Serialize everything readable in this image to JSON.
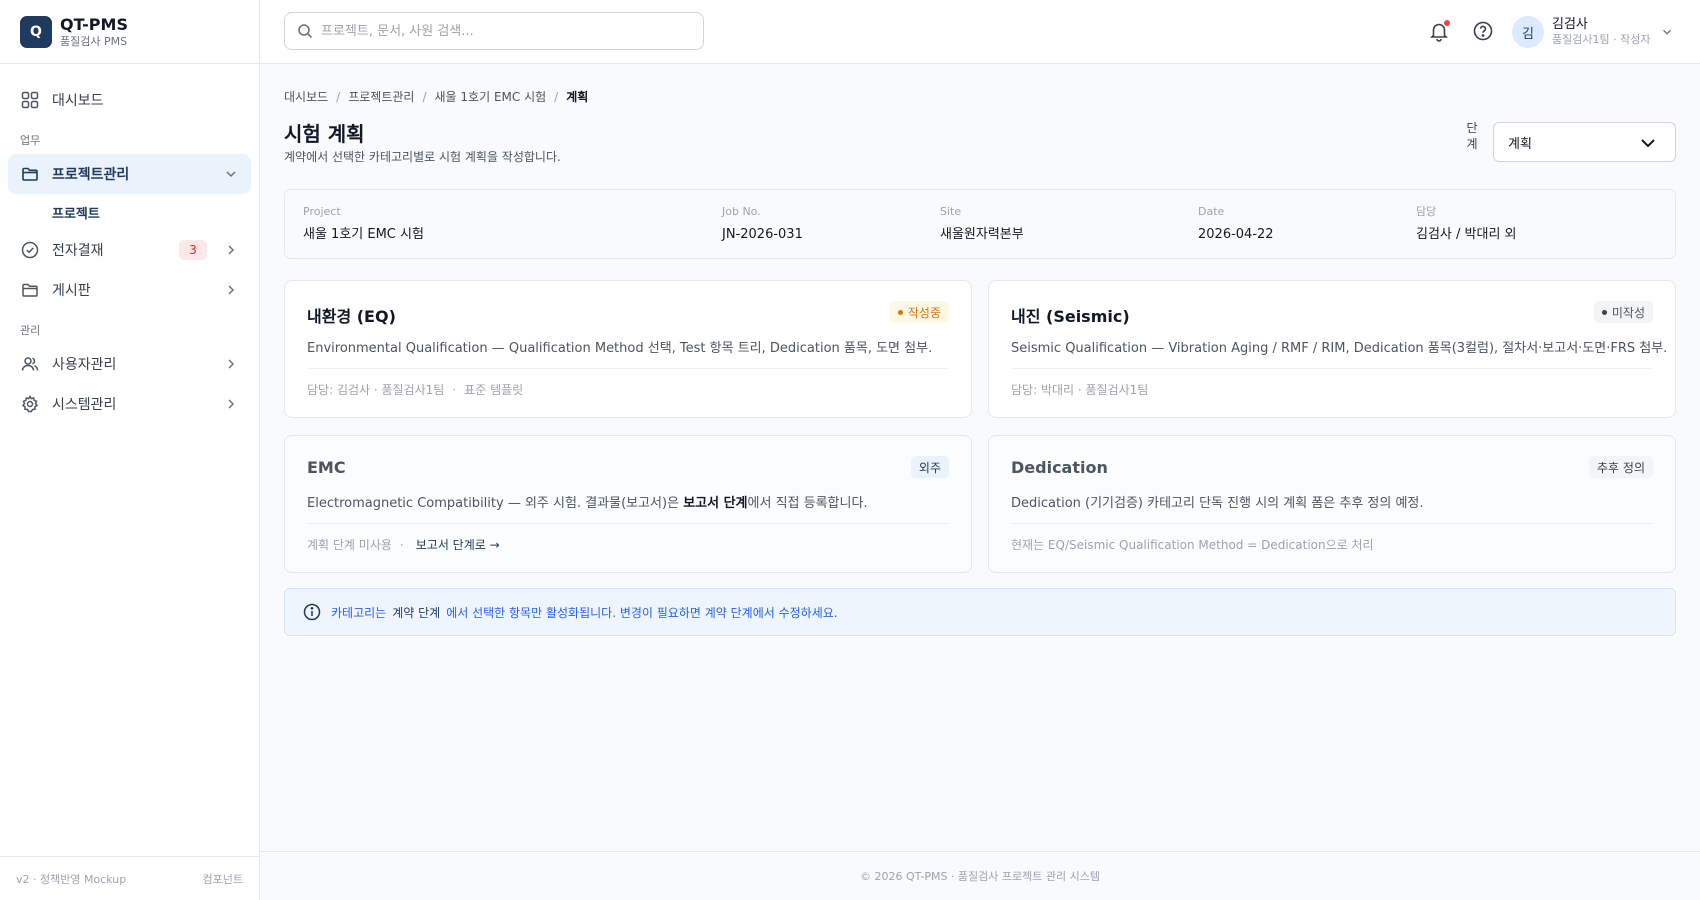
{
  "brand": {
    "logo_letter": "Q",
    "name": "QT-PMS",
    "subtitle": "품질검사 PMS"
  },
  "sidebar": {
    "dashboard": "대시보드",
    "section_work": "업무",
    "project_mgmt": "프로젝트관리",
    "project_sub": "프로젝트",
    "approval": "전자결재",
    "approval_badge": "3",
    "board": "게시판",
    "section_admin": "관리",
    "user_mgmt": "사용자관리",
    "system_mgmt": "시스템관리",
    "footer_version": "v2 · 정책반영 Mockup",
    "footer_right": "컴포넌트"
  },
  "header": {
    "search_placeholder": "프로젝트, 문서, 사원 검색...",
    "user_initial": "김",
    "user_name": "김검사",
    "user_role": "품질검사1팀 · 작성자"
  },
  "breadcrumb": [
    "대시보드",
    "프로젝트관리",
    "새울 1호기 EMC 시험",
    "계획"
  ],
  "page": {
    "title": "시험 계획",
    "description": "계약에서 선택한 카테고리별로 시험 계획을 작성합니다.",
    "stage_label": "단계",
    "stage_value": "계획"
  },
  "info": {
    "project_label": "Project",
    "project_value": "새울 1호기 EMC 시험",
    "job_label": "Job No.",
    "job_value": "JN-2026-031",
    "site_label": "Site",
    "site_value": "새울원자력본부",
    "date_label": "Date",
    "date_value": "2026-04-22",
    "owner_label": "담당",
    "owner_value": "김검사 / 박대리 외"
  },
  "cards": {
    "eq": {
      "title": "내환경 (EQ)",
      "status": "작성중",
      "status_color": "#d97706",
      "desc": "Environmental Qualification — Qualification Method 선택, Test 항목 트리, Dedication 품목, 도면 첨부.",
      "owner": "담당: 김검사 · 품질검사1팀",
      "template": "표준 템플릿"
    },
    "seismic": {
      "title": "내진 (Seismic)",
      "status": "미작성",
      "status_color": "#374151",
      "desc": "Seismic Qualification — Vibration Aging / RMF / RIM, Dedication 품목(3컬럼), 절차서·보고서·도면·FRS 첨부.",
      "owner": "담당: 박대리 · 품질검사1팀"
    },
    "emc": {
      "title": "EMC",
      "status": "외주",
      "desc_prefix": "Electromagnetic Compatibility — 외주 시험. 결과물(보고서)은 ",
      "desc_bold": "보고서 단계",
      "desc_suffix": "에서 직접 등록합니다.",
      "foot_note": "계획 단계 미사용",
      "foot_link": "보고서 단계로 →"
    },
    "dedication": {
      "title": "Dedication",
      "status": "추후 정의",
      "desc": "Dedication (기기검증) 카테고리 단독 진행 시의 계획 폼은 추후 정의 예정.",
      "foot": "현재는 EQ/Seismic Qualification Method = Dedication으로 처리"
    }
  },
  "alert": {
    "text1": "카테고리는",
    "chip": "계약 단계",
    "text2": "에서 선택한 항목만 활성화됩니다. 변경이 필요하면 계약 단계에서 수정하세요."
  },
  "footer": {
    "text": "© 2026 QT-PMS · 품질검사 프로젝트 관리 시스템"
  },
  "colors": {
    "brand": "#1e3a5f",
    "active_bg": "#eaf2fb",
    "alert_text": "#2563eb",
    "badge_red": "#dc2626"
  }
}
